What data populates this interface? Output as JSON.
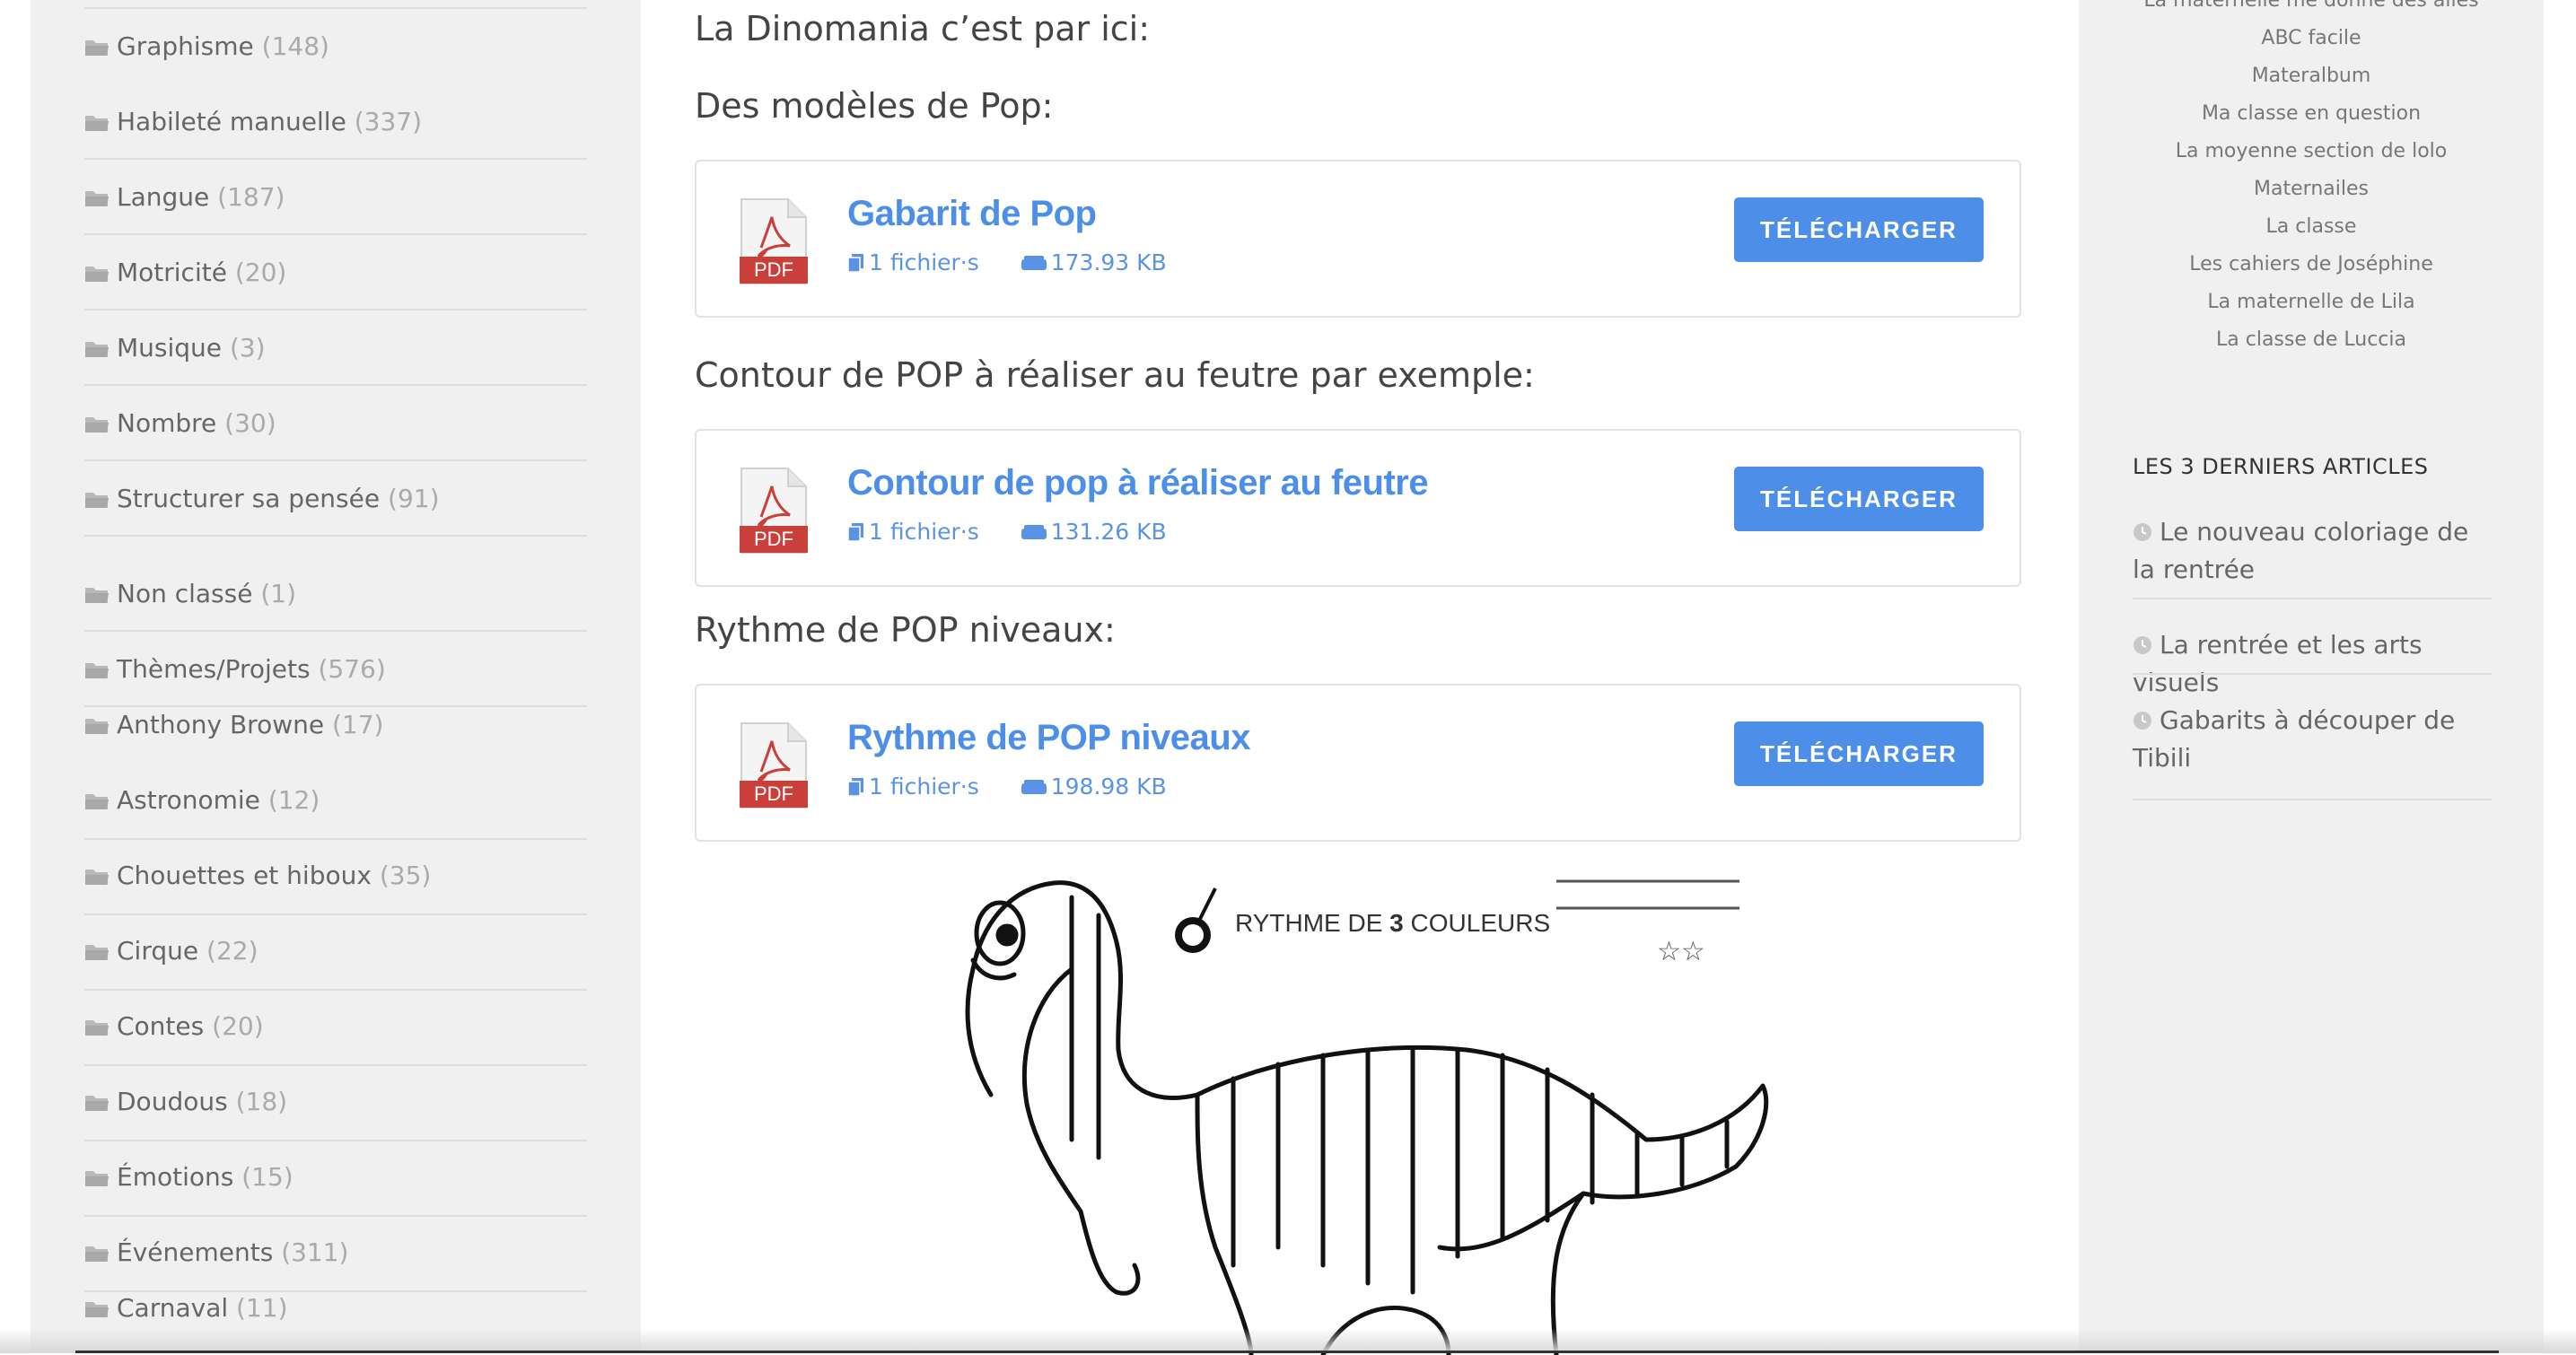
{
  "categories": [
    {
      "label": "Graphisme",
      "count": "(148)"
    },
    {
      "label": "Habileté manuelle",
      "count": "(337)"
    },
    {
      "label": "Langue",
      "count": "(187)"
    },
    {
      "label": "Motricité",
      "count": "(20)"
    },
    {
      "label": "Musique",
      "count": "(3)"
    },
    {
      "label": "Nombre",
      "count": "(30)"
    },
    {
      "label": "Structurer sa pensée",
      "count": "(91)"
    },
    {
      "label": "Non classé",
      "count": "(1)"
    },
    {
      "label": "Thèmes/Projets",
      "count": "(576)"
    },
    {
      "label": "Anthony Browne",
      "count": "(17)"
    },
    {
      "label": "Astronomie",
      "count": "(12)"
    },
    {
      "label": "Chouettes et hiboux",
      "count": "(35)"
    },
    {
      "label": "Cirque",
      "count": "(22)"
    },
    {
      "label": "Contes",
      "count": "(20)"
    },
    {
      "label": "Doudous",
      "count": "(18)"
    },
    {
      "label": "Émotions",
      "count": "(15)"
    },
    {
      "label": "Événements",
      "count": "(311)"
    },
    {
      "label": "Carnaval",
      "count": "(11)"
    }
  ],
  "main": {
    "intro": "La Dinomania c’est par ici:",
    "heading1": "Des modèles de Pop:",
    "heading2": "Contour de POP à réaliser au feutre par exemple:",
    "heading3": "Rythme de POP niveaux:",
    "files": [
      {
        "title": "Gabarit de Pop",
        "files": "1 fichier·s",
        "size": "173.93 KB",
        "button": "TÉLÉCHARGER",
        "icon_label": "PDF"
      },
      {
        "title": "Contour de pop à réaliser au feutre",
        "files": "1 fichier·s",
        "size": "131.26 KB",
        "button": "TÉLÉCHARGER",
        "icon_label": "PDF"
      },
      {
        "title": "Rythme de POP niveaux",
        "files": "1 fichier·s",
        "size": "198.98 KB",
        "button": "TÉLÉCHARGER",
        "icon_label": "PDF"
      }
    ],
    "image": {
      "heading_prefix": "RYTHME DE ",
      "heading_number": "3",
      "heading_suffix": " COULEURS",
      "stars": "☆☆"
    }
  },
  "right_sidebar": {
    "blogs": [
      "La maternelle me donne des ailes",
      "ABC facile",
      "Materalbum",
      "Ma classe en question",
      "La moyenne section de lolo",
      "Maternailes",
      "La classe",
      "Les cahiers de Joséphine",
      "La maternelle de Lila",
      "La classe de Luccia"
    ],
    "widget_title": "LES 3 DERNIERS ARTICLES",
    "articles": [
      "Le nouveau coloriage de la rentrée",
      "La rentrée et les arts visuels",
      "Gabarits à découper de Tibili"
    ]
  },
  "colors": {
    "accent": "#4d8fe8",
    "sidebar_bg": "#f0f0f0",
    "pdf_red": "#c9403a"
  }
}
